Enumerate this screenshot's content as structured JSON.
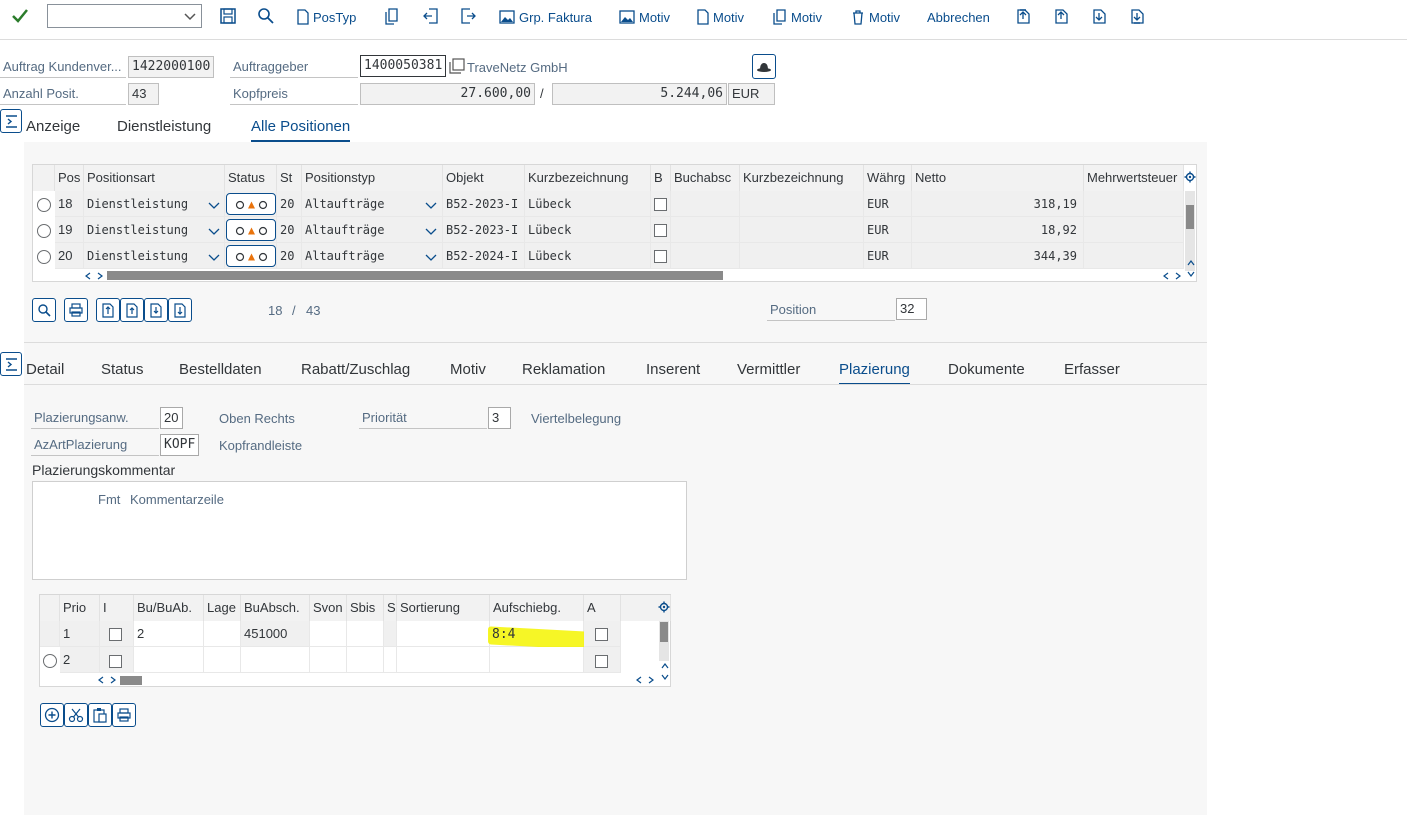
{
  "toolbar": {
    "combo_value": "",
    "buttons": {
      "postyp": "PosTyp",
      "grp_faktura": "Grp. Faktura",
      "motiv1": "Motiv",
      "motiv2": "Motiv",
      "motiv3": "Motiv",
      "motiv4": "Motiv",
      "abbrechen": "Abbrechen"
    }
  },
  "header": {
    "auftrag_label": "Auftrag Kundenver...",
    "auftrag_value": "1422000100",
    "auftraggeber_label": "Auftraggeber",
    "auftraggeber_value": "1400050381",
    "auftraggeber_name": "TraveNetz GmbH",
    "anzahl_label": "Anzahl Posit.",
    "anzahl_value": "43",
    "kopfpreis_label": "Kopfpreis",
    "kopfpreis_value": "27.600,00",
    "separator": "/",
    "kopfpreis_value2": "5.244,06",
    "currency": "EUR"
  },
  "top_tabs": [
    "Anzeige",
    "Dienstleistung",
    "Alle Positionen"
  ],
  "positions_table": {
    "columns": [
      "Pos",
      "Positionsart",
      "Status",
      "St",
      "Positionstyp",
      "Objekt",
      "Kurzbezeichnung",
      "B",
      "Buchabsc",
      "Kurzbezeichnung",
      "Währg",
      "Netto",
      "Mehrwertsteuer"
    ],
    "rows": [
      {
        "pos": "18",
        "art": "Dienstleistung",
        "st": "20",
        "typ": "Altaufträge",
        "objekt": "B52-2023-I",
        "kurz": "Lübeck",
        "waehrg": "EUR",
        "netto": "318,19"
      },
      {
        "pos": "19",
        "art": "Dienstleistung",
        "st": "20",
        "typ": "Altaufträge",
        "objekt": "B52-2023-I",
        "kurz": "Lübeck",
        "waehrg": "EUR",
        "netto": "18,92"
      },
      {
        "pos": "20",
        "art": "Dienstleistung",
        "st": "20",
        "typ": "Altaufträge",
        "objekt": "B52-2024-I",
        "kurz": "Lübeck",
        "waehrg": "EUR",
        "netto": "344,39"
      }
    ],
    "pager_current": "18",
    "pager_sep": "/",
    "pager_total": "43",
    "position_label": "Position",
    "position_value": "32"
  },
  "detail_tabs": [
    "Detail",
    "Status",
    "Bestelldaten",
    "Rabatt/Zuschlag",
    "Motiv",
    "Reklamation",
    "Inserent",
    "Vermittler",
    "Plazierung",
    "Dokumente",
    "Erfasser"
  ],
  "plazierung": {
    "anw_label": "Plazierungsanw.",
    "anw_value": "20",
    "anw_text": "Oben Rechts",
    "prio_label": "Priorität",
    "prio_value": "3",
    "prio_text": "Viertelbelegung",
    "azart_label": "AzArtPlazierung",
    "azart_value": "KOPF",
    "azart_text": "Kopfrandleiste",
    "kommentar_label": "Plazierungskommentar",
    "kommentar_fmt": "Fmt",
    "kommentar_col": "Kommentarzeile"
  },
  "prio_table": {
    "columns": [
      "Prio",
      "I",
      "Bu/BuAb.",
      "Lage",
      "BuAbsch.",
      "Svon",
      "Sbis",
      "S",
      "Sortierung",
      "Aufschiebg.",
      "A"
    ],
    "rows": [
      {
        "prio": "1",
        "bu": "2",
        "buabsch": "451000",
        "aufschiebg": "8:4"
      },
      {
        "prio": "2",
        "bu": "",
        "buabsch": "",
        "aufschiebg": ""
      }
    ]
  }
}
